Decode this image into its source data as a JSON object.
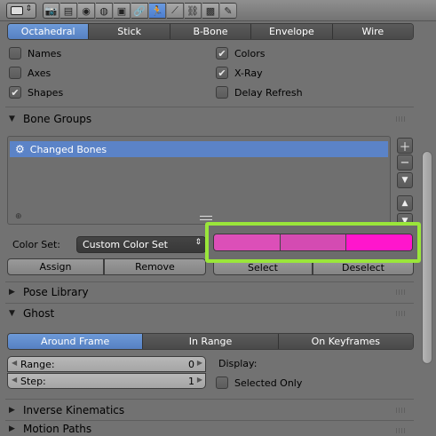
{
  "header": {
    "icons": [
      "render-icon",
      "scene-icon",
      "world-icon",
      "object-icon",
      "constraints-icon",
      "modifiers-icon",
      "armature-data-icon",
      "bone-icon",
      "bone-constraint-icon",
      "material-icon",
      "texture-icon"
    ]
  },
  "display": {
    "tabs": [
      "Octahedral",
      "Stick",
      "B-Bone",
      "Envelope",
      "Wire"
    ],
    "active_tab": "Octahedral",
    "options": {
      "names": {
        "label": "Names",
        "checked": false
      },
      "colors": {
        "label": "Colors",
        "checked": true
      },
      "axes": {
        "label": "Axes",
        "checked": false
      },
      "xray": {
        "label": "X-Ray",
        "checked": true
      },
      "shapes": {
        "label": "Shapes",
        "checked": true
      },
      "delay_refresh": {
        "label": "Delay Refresh",
        "checked": false
      }
    }
  },
  "bone_groups": {
    "title": "Bone Groups",
    "items": [
      {
        "label": "Changed Bones",
        "selected": true
      }
    ],
    "color_set_label": "Color Set:",
    "color_set_value": "Custom Color Set",
    "swatches": [
      "#dc4fb8",
      "#d44bb2",
      "#ff16cc"
    ],
    "highlight_color": "#9ae63a",
    "buttons": {
      "assign": "Assign",
      "remove": "Remove",
      "select": "Select",
      "deselect": "Deselect"
    }
  },
  "pose_library": {
    "title": "Pose Library"
  },
  "ghost": {
    "title": "Ghost",
    "tabs": [
      "Around Frame",
      "In Range",
      "On Keyframes"
    ],
    "active_tab": "Around Frame",
    "range": {
      "label": "Range:",
      "value": "0"
    },
    "step": {
      "label": "Step:",
      "value": "1"
    },
    "display_label": "Display:",
    "selected_only": {
      "label": "Selected Only",
      "checked": false
    }
  },
  "inverse_kinematics": {
    "title": "Inverse Kinematics"
  },
  "motion_paths": {
    "title": "Motion Paths"
  }
}
